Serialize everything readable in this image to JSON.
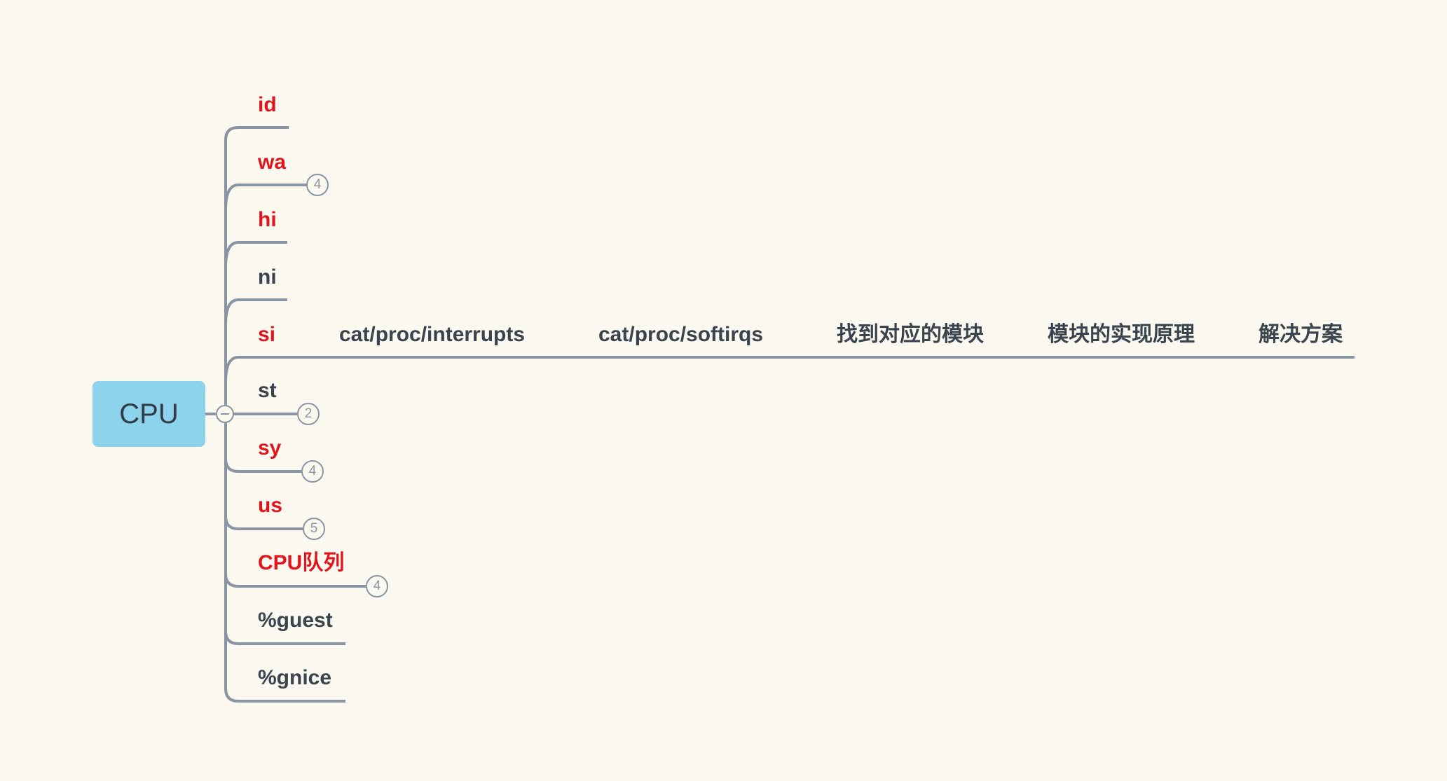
{
  "root": {
    "label": "CPU"
  },
  "colors": {
    "red": "#e0161c",
    "dark": "#3a444e",
    "line": "#8a95a3"
  },
  "branches": [
    {
      "label": "id",
      "color": "red"
    },
    {
      "label": "wa",
      "color": "red",
      "count": "4"
    },
    {
      "label": "hi",
      "color": "red"
    },
    {
      "label": "ni",
      "color": "dark"
    },
    {
      "label": "si",
      "color": "red",
      "children": [
        "cat/proc/interrupts",
        "cat/proc/softirqs",
        "找到对应的模块",
        "模块的实现原理",
        "解决方案"
      ]
    },
    {
      "label": "st",
      "color": "dark",
      "count": "2"
    },
    {
      "label": "sy",
      "color": "red",
      "count": "4"
    },
    {
      "label": "us",
      "color": "red",
      "count": "5"
    },
    {
      "label": "CPU队列",
      "color": "red",
      "count": "4"
    },
    {
      "label": "%guest",
      "color": "dark"
    },
    {
      "label": "%gnice",
      "color": "dark"
    }
  ]
}
